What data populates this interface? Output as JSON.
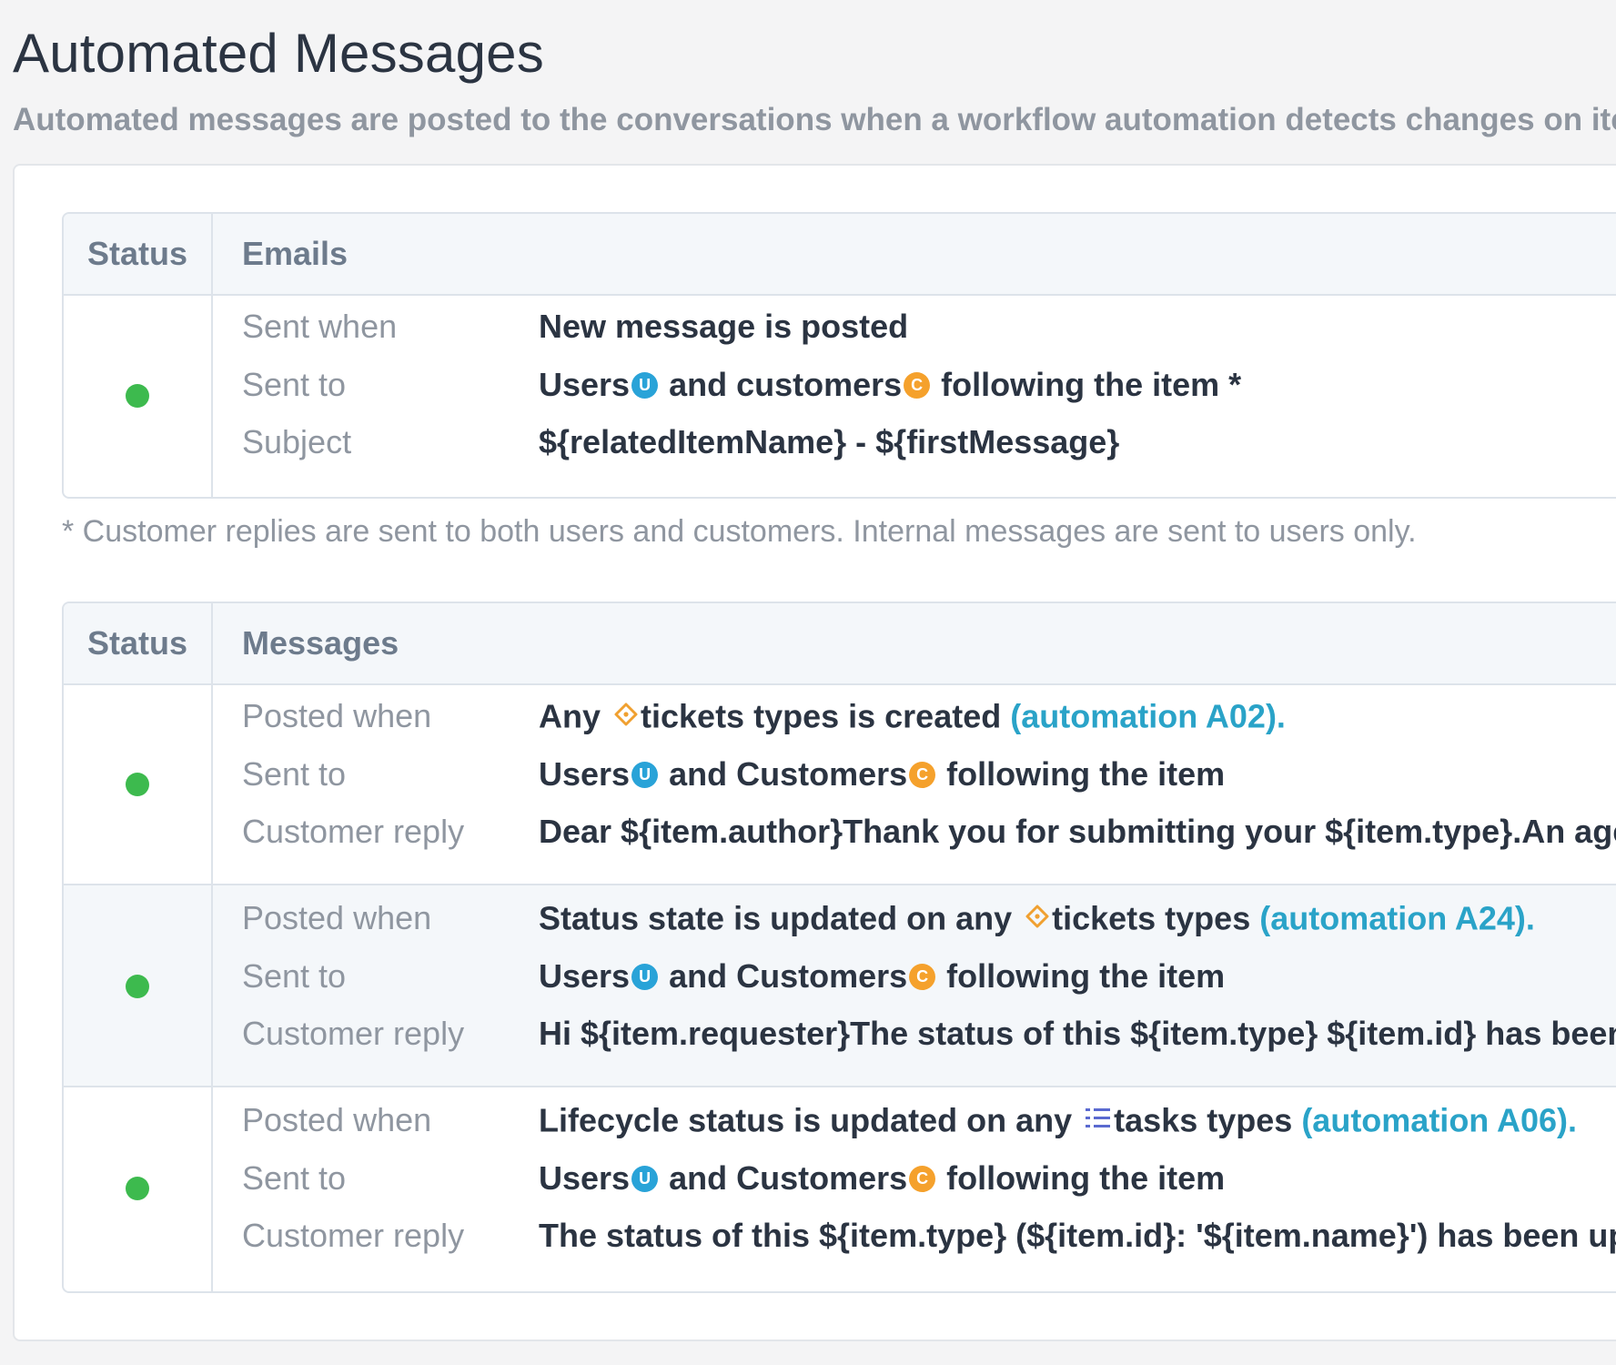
{
  "page": {
    "title": "Automated Messages",
    "description": "Automated messages are posted to the conversations when a workflow automation detects changes on items. U"
  },
  "emails_table": {
    "status_header": "Status",
    "title_header": "Emails",
    "status": "enabled",
    "status_color": "#3dba4e",
    "rows": {
      "sent_when_label": "Sent when",
      "sent_when_value": "New message is posted",
      "sent_to_label": "Sent to",
      "sent_to_users": "Users",
      "sent_to_mid": "and customers",
      "sent_to_end": "following the item *",
      "subject_label": "Subject",
      "subject_value": "${relatedItemName} - ${firstMessage}"
    },
    "footnote": "* Customer replies are sent to both users and customers. Internal messages are sent to users only."
  },
  "badges": {
    "user_letter": "U",
    "customer_letter": "C",
    "user_color": "#29a3d8",
    "customer_color": "#f5a12c"
  },
  "messages_table": {
    "status_header": "Status",
    "title_header": "Messages",
    "labels": {
      "posted_when": "Posted when",
      "sent_to": "Sent to",
      "customer_reply": "Customer reply"
    },
    "items": [
      {
        "status": "enabled",
        "posted_when_prefix": "Any",
        "posted_when_type_icon": "ticket-icon",
        "posted_when_type": "tickets types is created",
        "posted_when_link": "(automation A02).",
        "sent_to_users": "Users",
        "sent_to_mid": "and Customers",
        "sent_to_end": "following the item",
        "customer_reply": "Dear ${item.author}Thank you for submitting your ${item.type}.An agent h"
      },
      {
        "status": "enabled",
        "posted_when_prefix": "Status state is updated on any",
        "posted_when_type_icon": "ticket-icon",
        "posted_when_type": "tickets types",
        "posted_when_link": "(automation A24).",
        "sent_to_users": "Users",
        "sent_to_mid": "and Customers",
        "sent_to_end": "following the item",
        "customer_reply": "Hi ${item.requester}The status of this ${item.type} ${item.id} has been mar"
      },
      {
        "status": "enabled",
        "posted_when_prefix": "Lifecycle status is updated on any",
        "posted_when_type_icon": "task-list-icon",
        "posted_when_type": "tasks types",
        "posted_when_link": "(automation A06).",
        "sent_to_users": "Users",
        "sent_to_mid": "and Customers",
        "sent_to_end": "following the item",
        "customer_reply": "The status of this ${item.type} (${item.id}: '${item.name}') has been updated"
      }
    ]
  }
}
